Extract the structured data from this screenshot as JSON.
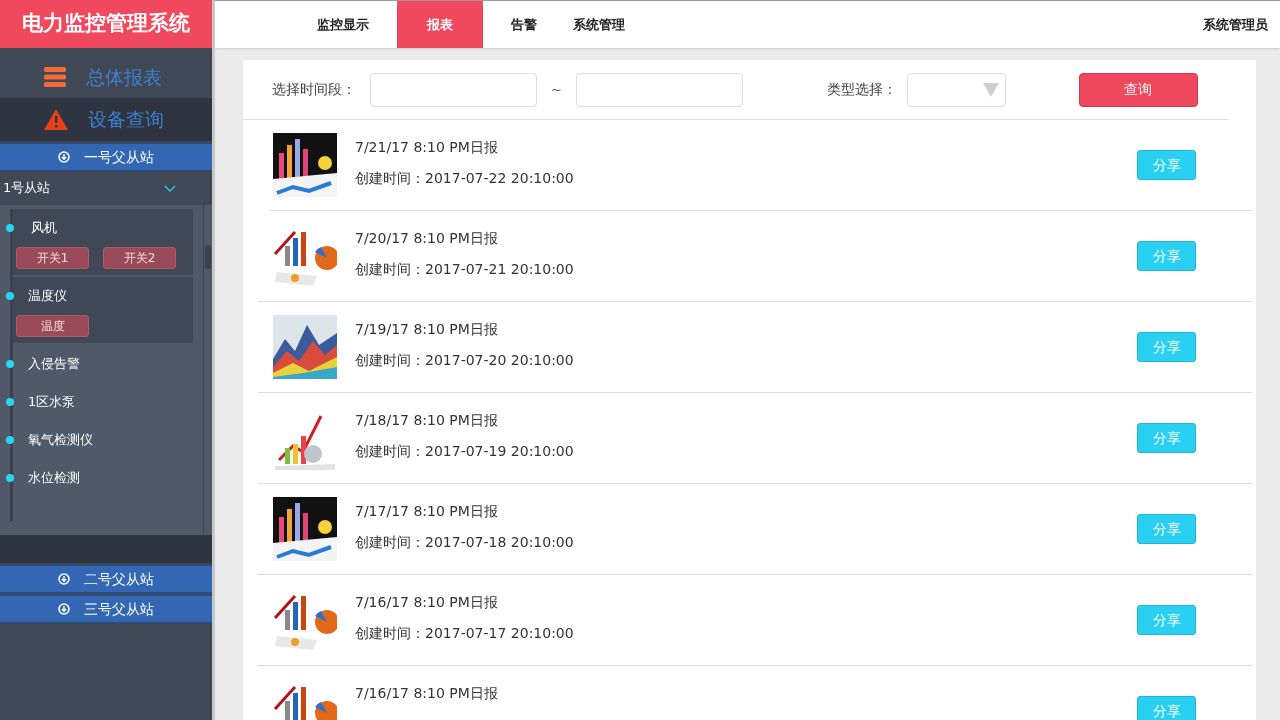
{
  "app_title": "电力监控管理系统",
  "nav": {
    "tabs": [
      {
        "label": "监控显示",
        "selected": false
      },
      {
        "label": "报表",
        "selected": true
      },
      {
        "label": "告警",
        "selected": false
      },
      {
        "label": "系统管理",
        "selected": false
      }
    ],
    "user": "系统管理员"
  },
  "sidebar": {
    "menu": [
      {
        "label": "总体报表",
        "selected": false,
        "kind": "stack"
      },
      {
        "label": "设备查询",
        "selected": true,
        "kind": "warning"
      }
    ],
    "stations": [
      {
        "label": "一号父从站",
        "substation": "1号从站",
        "devices": [
          {
            "name": "风机",
            "buttons": [
              "开关1",
              "开关2"
            ]
          },
          {
            "name": "温度仪",
            "buttons": [
              "温度"
            ]
          },
          {
            "name": "入侵告警"
          },
          {
            "name": "1区水泵"
          },
          {
            "name": "氧气检测仪"
          },
          {
            "name": "水位检测"
          }
        ]
      },
      {
        "label": "二号父从站"
      },
      {
        "label": "三号父从站"
      }
    ]
  },
  "filter": {
    "period_label": "选择时间段：",
    "separator": "~",
    "type_label": "类型选择：",
    "query_button": "查询"
  },
  "reports": [
    {
      "title": "7/21/17 8:10 PM日报",
      "created": "创建时间：2017-07-22 20:10:00",
      "button": "分享"
    },
    {
      "title": "7/20/17 8:10 PM日报",
      "created": "创建时间：2017-07-21 20:10:00",
      "button": "分享"
    },
    {
      "title": "7/19/17 8:10 PM日报",
      "created": "创建时间：2017-07-20 20:10:00",
      "button": "分享"
    },
    {
      "title": "7/18/17 8:10 PM日报",
      "created": "创建时间：2017-07-19 20:10:00",
      "button": "分享"
    },
    {
      "title": "7/17/17 8:10 PM日报",
      "created": "创建时间：2017-07-18 20:10:00",
      "button": "分享"
    },
    {
      "title": "7/16/17 8:10 PM日报",
      "created": "创建时间：2017-07-17 20:10:00",
      "button": "分享"
    },
    {
      "title": "7/16/17 8:10 PM日报",
      "button": "分享"
    }
  ]
}
